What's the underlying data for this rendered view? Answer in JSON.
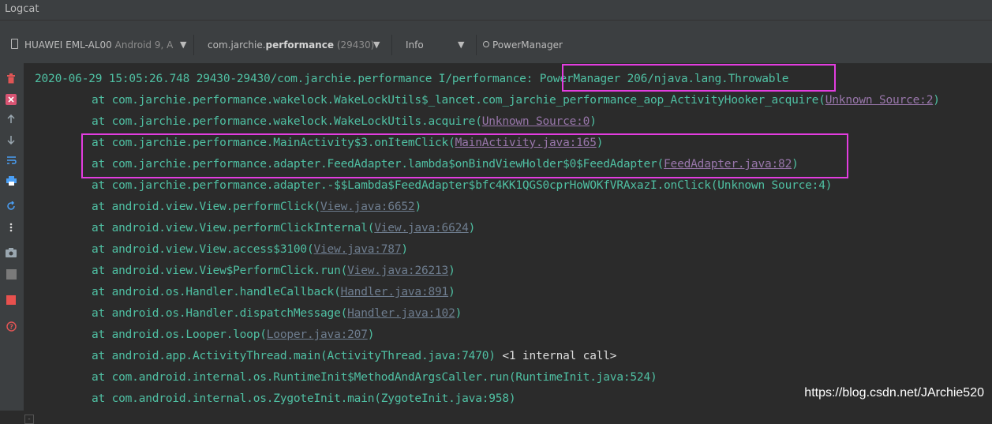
{
  "window": {
    "title": "Logcat"
  },
  "toolbar": {
    "device_name": "HUAWEI EML-AL00",
    "device_detail": "Android 9, A",
    "process_prefix": "com.jarchie.",
    "process_bold": "performance",
    "process_pid": "(29430)",
    "level": "Info",
    "search_value": "PowerManager",
    "dropdown_arrow": "▼"
  },
  "sidebar": {
    "icons": [
      "trash-icon",
      "clear-icon",
      "scroll-up-icon",
      "scroll-down-icon",
      "soft-wrap-icon",
      "print-icon",
      "restart-icon",
      "more-icon",
      "screenshot-icon",
      "screen-record-icon",
      "stop-icon",
      "help-icon"
    ]
  },
  "log": {
    "line0": {
      "prefix": "2020-06-29 15:05:26.748 29430-29430/com.jarchie.performance I/performance: ",
      "message": "PowerManager 206/njava.lang.Throwable"
    },
    "line1": {
      "text": "at com.jarchie.performance.wakelock.WakeLockUtils$_lancet.com_jarchie_performance_aop_ActivityHooker_acquire(",
      "link": "Unknown Source:2",
      "suffix": ")"
    },
    "line2": {
      "text": "at com.jarchie.performance.wakelock.WakeLockUtils.acquire(",
      "link": "Unknown Source:0",
      "suffix": ")"
    },
    "line3": {
      "text": "at com.jarchie.performance.MainActivity$3.onItemClick(",
      "link": "MainActivity.java:165",
      "suffix": ")"
    },
    "line4": {
      "text": "at com.jarchie.performance.adapter.FeedAdapter.lambda$onBindViewHolder$0$FeedAdapter(",
      "link": "FeedAdapter.java:82",
      "suffix": ")"
    },
    "line5": {
      "text": "at com.jarchie.performance.adapter.-$$Lambda$FeedAdapter$bfc4KK1QGS0cprHoWOKfVRAxazI.onClick(Unknown Source:4)"
    },
    "line6": {
      "text": "at android.view.View.performClick(",
      "link": "View.java:6652",
      "suffix": ")"
    },
    "line7": {
      "text": "at android.view.View.performClickInternal(",
      "link": "View.java:6624",
      "suffix": ")"
    },
    "line8": {
      "text": "at android.view.View.access$3100(",
      "link": "View.java:787",
      "suffix": ")"
    },
    "line9": {
      "text": "at android.view.View$PerformClick.run(",
      "link": "View.java:26213",
      "suffix": ")"
    },
    "line10": {
      "text": "at android.os.Handler.handleCallback(",
      "link": "Handler.java:891",
      "suffix": ")"
    },
    "line11": {
      "text": "at android.os.Handler.dispatchMessage(",
      "link": "Handler.java:102",
      "suffix": ")"
    },
    "line12": {
      "text": "at android.os.Looper.loop(",
      "link": "Looper.java:207",
      "suffix": ")"
    },
    "line13": {
      "text": "at android.app.ActivityThread.main(ActivityThread.java:7470)",
      "extra": " <1 internal call>"
    },
    "line14": {
      "text": "at com.android.internal.os.RuntimeInit$MethodAndArgsCaller.run(RuntimeInit.java:524)"
    },
    "line15": {
      "text": "at com.android.internal.os.ZygoteInit.main(ZygoteInit.java:958)"
    }
  },
  "watermark": "https://blog.csdn.net/JArchie520",
  "colors": {
    "log_text": "#4fc0a3",
    "link": "#9876aa",
    "highlight_box": "#e33de0",
    "background": "#2b2b2b"
  }
}
